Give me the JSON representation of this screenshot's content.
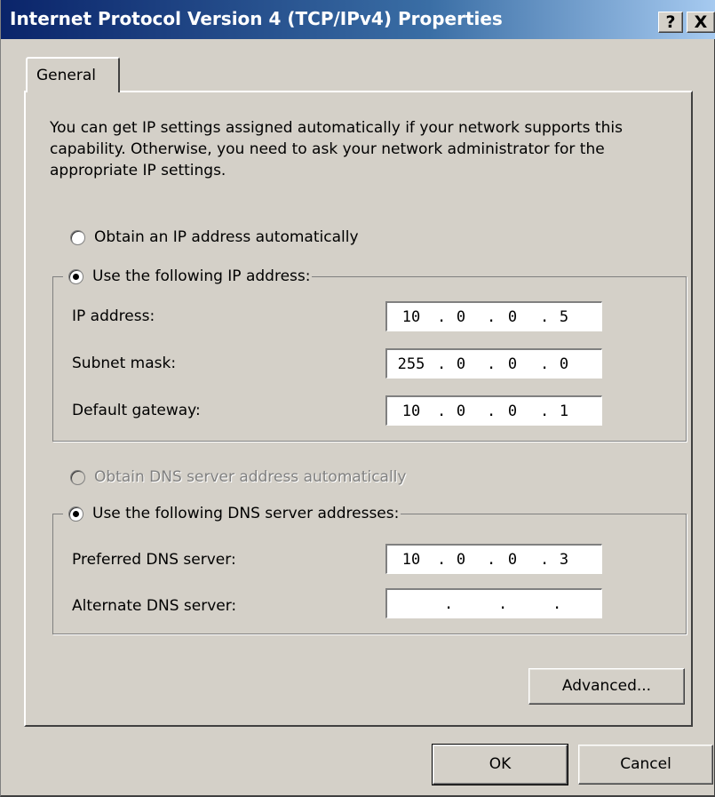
{
  "window": {
    "title": "Internet Protocol Version 4 (TCP/IPv4) Properties",
    "help_label": "?",
    "close_label": "X"
  },
  "tabs": [
    {
      "label": "General",
      "active": true
    }
  ],
  "description": "You can get IP settings assigned automatically if your network supports this capability. Otherwise, you need to ask your network administrator for the appropriate IP settings.",
  "ip_section": {
    "auto_label": "Obtain an IP address automatically",
    "manual_label": "Use the following IP address:",
    "selected": "manual",
    "fields": [
      {
        "label": "IP address:",
        "octets": [
          "10",
          "0",
          "0",
          "5"
        ]
      },
      {
        "label": "Subnet mask:",
        "octets": [
          "255",
          "0",
          "0",
          "0"
        ]
      },
      {
        "label": "Default gateway:",
        "octets": [
          "10",
          "0",
          "0",
          "1"
        ]
      }
    ]
  },
  "dns_section": {
    "auto_label": "Obtain DNS server address automatically",
    "manual_label": "Use the following DNS server addresses:",
    "selected": "manual",
    "auto_disabled": true,
    "fields": [
      {
        "label": "Preferred DNS server:",
        "octets": [
          "10",
          "0",
          "0",
          "3"
        ]
      },
      {
        "label": "Alternate DNS server:",
        "octets": [
          "",
          "",
          "",
          ""
        ]
      }
    ]
  },
  "buttons": {
    "advanced": "Advanced...",
    "ok": "OK",
    "cancel": "Cancel"
  },
  "colors": {
    "dialog_bg": "#d4d0c8",
    "title_start": "#0a246a",
    "title_end": "#a6caf0"
  }
}
